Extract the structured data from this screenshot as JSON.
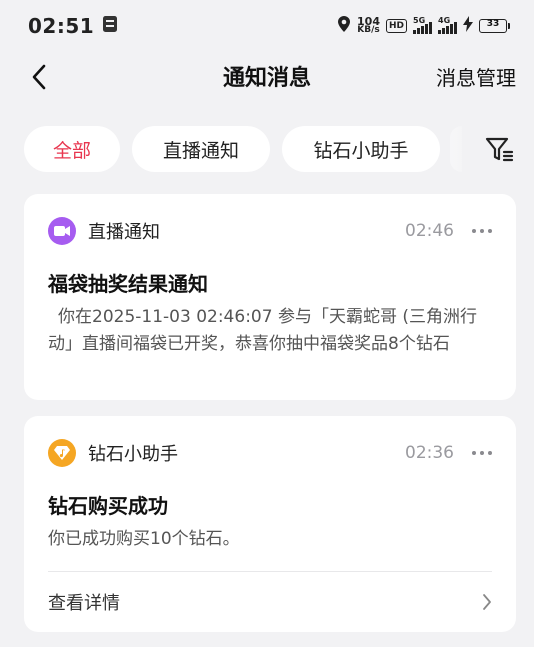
{
  "status_bar": {
    "time": "02:51",
    "net_speed_value": "104",
    "net_speed_unit": "KB/s",
    "hd_label": "HD",
    "sig1_label": "5G",
    "sig2_label": "4G",
    "battery_level": "33",
    "battery_color": "#3ec94a"
  },
  "nav": {
    "title": "通知消息",
    "manage_label": "消息管理"
  },
  "filters": {
    "items": [
      {
        "label": "全部",
        "active": true
      },
      {
        "label": "直播通知",
        "active": false
      },
      {
        "label": "钻石小助手",
        "active": false
      }
    ],
    "accent_color": "#e8364f"
  },
  "notifications": [
    {
      "source": "直播通知",
      "icon": "live-camera-icon",
      "icon_color": "#a65cf0",
      "time": "02:46",
      "title": "福袋抽奖结果通知",
      "body": "你在2025-11-03 02:46:07 参与「天霸蛇哥 (三角洲行动」直播间福袋已开奖，恭喜你抽中福袋奖品8个钻石"
    },
    {
      "source": "钻石小助手",
      "icon": "diamond-music-icon",
      "icon_color": "#f5a623",
      "time": "02:36",
      "title": "钻石购买成功",
      "body": "你已成功购买10个钻石。",
      "detail_label": "查看详情"
    }
  ]
}
